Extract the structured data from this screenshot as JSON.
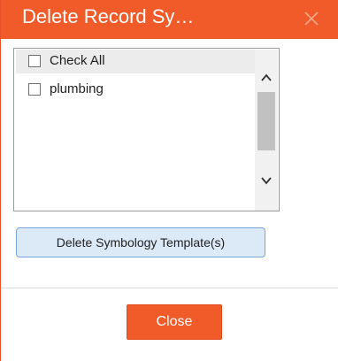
{
  "dialog": {
    "title": "Delete Record Sy…",
    "close_icon": "close-icon"
  },
  "list": {
    "items": [
      {
        "label": "Check All",
        "checked": false
      },
      {
        "label": "plumbing",
        "checked": false
      }
    ],
    "scrollbar": {
      "up_icon": "chevron-up-icon",
      "down_icon": "chevron-down-icon"
    }
  },
  "actions": {
    "delete_label": "Delete Symbology Template(s)",
    "close_label": "Close"
  },
  "colors": {
    "accent": "#f15a29",
    "button_bg": "#dce9f7",
    "button_border": "#7aa7d6"
  }
}
